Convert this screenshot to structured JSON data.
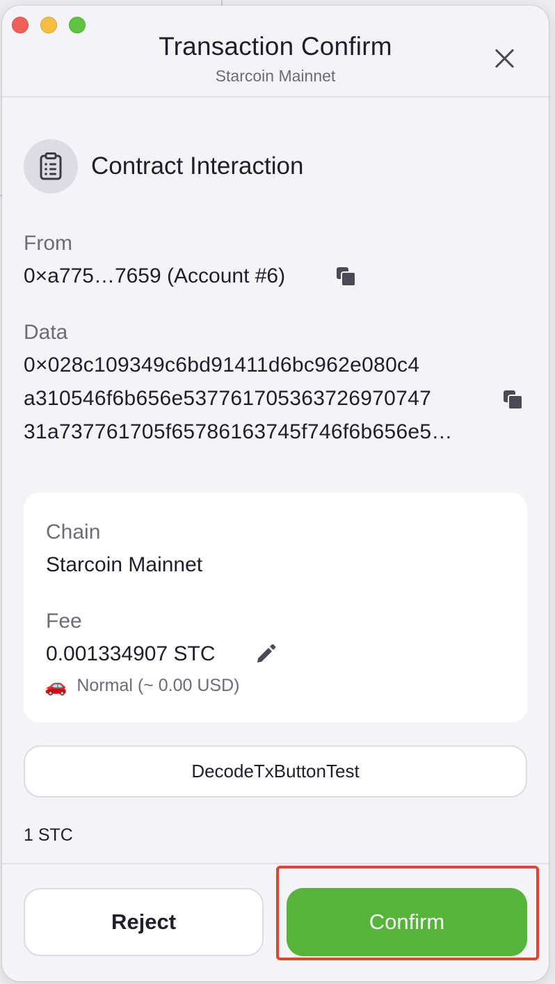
{
  "dialog": {
    "title": "Transaction Confirm",
    "subtitle": "Starcoin Mainnet",
    "close_icon": "close-icon"
  },
  "transaction": {
    "type_icon": "clipboard-icon",
    "type_label": "Contract Interaction",
    "from_label": "From",
    "from_value": "0×a775…7659 (Account #6)",
    "data_label": "Data",
    "data_lines": [
      "0×028c109349c6bd91411d6bc962e080c4",
      "a310546f6b656e537761705363726970747",
      "31a737761705f65786163745f746f6b656e5…"
    ],
    "copy_icon": "copy-icon"
  },
  "details": {
    "chain_label": "Chain",
    "chain_value": "Starcoin Mainnet",
    "fee_label": "Fee",
    "fee_value": "0.001334907 STC",
    "edit_icon": "pencil-icon",
    "speed_icon": "🚗",
    "speed_text": "Normal (~ 0.00 USD)"
  },
  "decode_button": "DecodeTxButtonTest",
  "amount": "1 STC",
  "footer": {
    "reject_label": "Reject",
    "confirm_label": "Confirm"
  },
  "colors": {
    "confirm": "#55b43a",
    "highlight": "#e2442f",
    "background": "#f4f4f6"
  }
}
